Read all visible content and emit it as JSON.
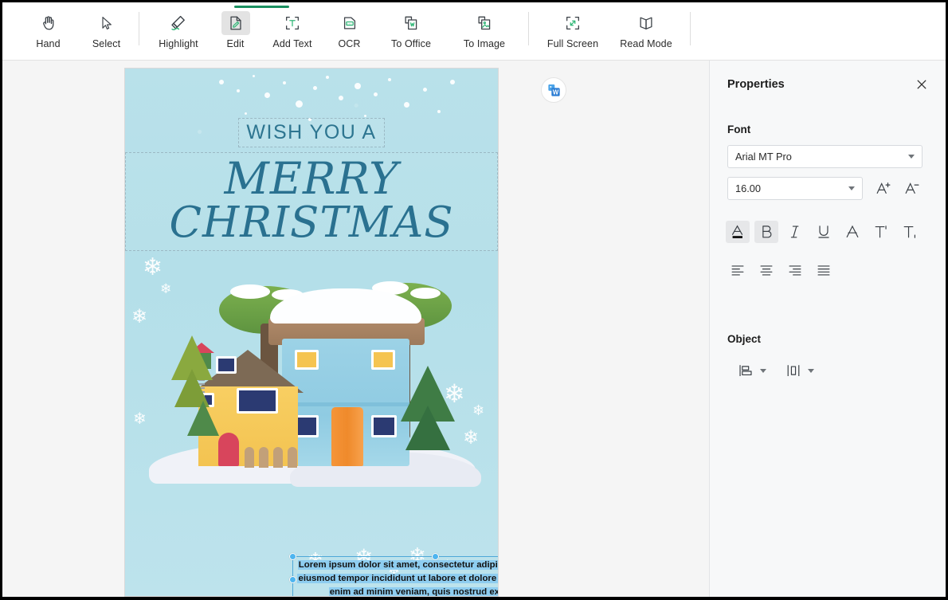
{
  "toolbar": {
    "items": [
      {
        "label": "Hand",
        "icon": "hand-icon",
        "active": false
      },
      {
        "label": "Select",
        "icon": "cursor-icon",
        "active": false
      },
      {
        "label": "Highlight",
        "icon": "highlighter-icon",
        "active": false
      },
      {
        "label": "Edit",
        "icon": "edit-page-icon",
        "active": true
      },
      {
        "label": "Add Text",
        "icon": "add-text-icon",
        "active": false
      },
      {
        "label": "OCR",
        "icon": "ocr-icon",
        "active": false
      },
      {
        "label": "To Office",
        "icon": "to-office-icon",
        "active": false
      },
      {
        "label": "To Image",
        "icon": "to-image-icon",
        "active": false
      },
      {
        "label": "Full Screen",
        "icon": "fullscreen-icon",
        "active": false
      },
      {
        "label": "Read Mode",
        "icon": "book-icon",
        "active": false
      }
    ],
    "accent_color": "#1a8f5f",
    "active_index": 3
  },
  "floating": {
    "to_word_label": "To Word",
    "icon": "word-icon",
    "brand_color": "#2b7cd3"
  },
  "document": {
    "card": {
      "background_color": "#b7e0ea",
      "title_color": "#2a7190",
      "line1": "WISH YOU A",
      "line2": "MERRY",
      "line3": "CHRISTMAS"
    },
    "body_text": {
      "selected": true,
      "line1": "Lorem ipsum dolor sit amet, consectetur adipiscing elit, sed do",
      "line2": "eiusmod tempor incididunt ut labore et dolore magna aliqua. Ut",
      "line3": "enim ad minim veniam, quis nostrud exercitation",
      "selection_color": "#8ecdf0",
      "handle_color": "#4eb5ef"
    }
  },
  "panel": {
    "title": "Properties",
    "close_icon": "close-icon",
    "font_section_label": "Font",
    "font_family_value": "Arial MT Pro",
    "font_size_value": "16.00",
    "increase_font_icon": "increase-font-size-icon",
    "decrease_font_icon": "decrease-font-size-icon",
    "style_buttons": [
      {
        "name": "font-color-button",
        "glyph": "A",
        "active": true
      },
      {
        "name": "bold-button",
        "glyph": "B",
        "active": true
      },
      {
        "name": "italic-button",
        "glyph": "I",
        "active": false
      },
      {
        "name": "underline-button",
        "glyph": "U",
        "active": false
      },
      {
        "name": "strikethrough-button",
        "glyph": "A",
        "active": false
      },
      {
        "name": "superscript-button",
        "glyph": "T",
        "active": false
      },
      {
        "name": "subscript-button",
        "glyph": "T",
        "active": false
      }
    ],
    "align_buttons": [
      {
        "name": "align-left-button",
        "active": false
      },
      {
        "name": "align-center-button",
        "active": false
      },
      {
        "name": "align-right-button",
        "active": false
      },
      {
        "name": "align-justify-button",
        "active": false
      }
    ],
    "object_section_label": "Object",
    "object_buttons": [
      {
        "name": "align-objects-button",
        "icon": "align-objects-icon"
      },
      {
        "name": "distribute-objects-button",
        "icon": "distribute-objects-icon"
      }
    ]
  }
}
